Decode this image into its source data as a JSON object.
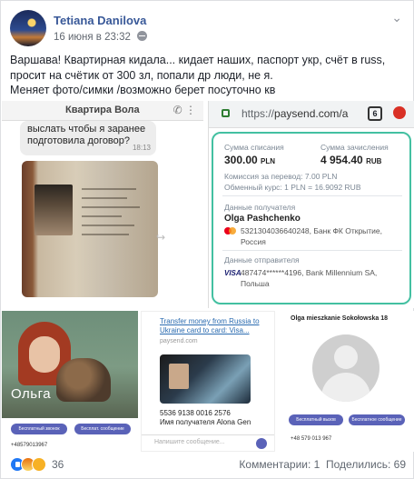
{
  "post": {
    "author": "Tetiana Danilova",
    "time": "16 июня в 23:32",
    "more": "⌄",
    "text_lines": [
      "Варшава! Квартирная кидала... кидает наших, паспорт укр, счёт в russ,",
      "просит на счётик от 300 зл, попали др люди, не я.",
      "Меняет фото/симки /возможно берет посуточно кв"
    ]
  },
  "photo1": {
    "title": "Квартира Вола",
    "bubble_text": "выслать чтобы я заранее подготовила договор?",
    "bubble_time": "18:13"
  },
  "photo2": {
    "url_scheme": "https://",
    "url_host": "paysend.com/a",
    "tabs_count": "6",
    "debit_label": "Сумма списания",
    "debit_value": "300.00",
    "debit_currency": "PLN",
    "credit_label": "Сумма зачисления",
    "credit_value": "4 954.40",
    "credit_currency": "RUB",
    "fee": "Комиссия за перевод: 7.00 PLN",
    "rate": "Обменный курс: 1 PLN = 16.9092 RUB",
    "recipient_label": "Данные получателя",
    "recipient_name": "Olga Pashchenko",
    "recipient_card": "5321304036640248, Банк ФК Открытие,",
    "recipient_country": "Россия",
    "sender_label": "Данные отправителя",
    "sender_card": "487474******4196, Bank Millennium SA,",
    "sender_country": "Польша",
    "visa_text": "VISA"
  },
  "photo3": {
    "name": "Ольга",
    "btn1": "Бесплатный звонок",
    "btn2": "Бесплат. сообщение",
    "phone": "+48579013967"
  },
  "photo4": {
    "link_text": "Transfer money from Russia to Ukraine card to card: Visa...",
    "domain": "paysend.com",
    "account_line1": "5536 9138 0016 2576",
    "account_line2": "Имя получателя Alona Gen",
    "message_placeholder": "Напишите сообщение..."
  },
  "photo5": {
    "title": "Olga mieszkanie Sokołowska 18",
    "btn1": "Бесплатный вызов",
    "btn2": "Бесплатное сообщение",
    "phone": "+48 579 013 967"
  },
  "footer": {
    "reaction_count": "36",
    "comments": "Комментарии: 1",
    "shares": "Поделились: 69"
  },
  "colors": {
    "accent": "#385898",
    "paysend": "#43c0a1"
  }
}
